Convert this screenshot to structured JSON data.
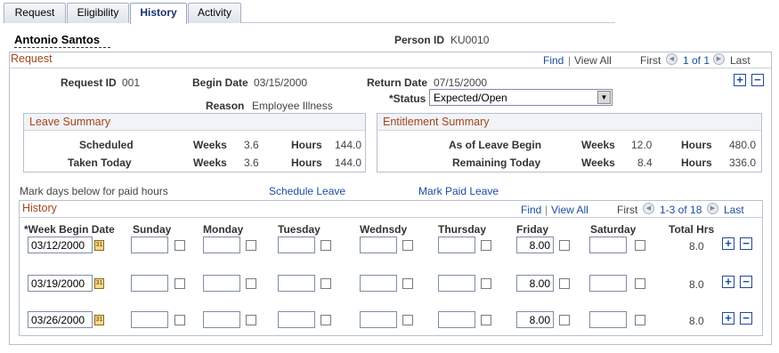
{
  "tabs": [
    "Request",
    "Eligibility",
    "History",
    "Activity"
  ],
  "person": {
    "name": "Antonio Santos",
    "id_label": "Person ID",
    "id_value": "KU0010"
  },
  "request": {
    "title": "Request",
    "find": "Find",
    "view_all": "View All",
    "first": "First",
    "range": "1 of 1",
    "last": "Last",
    "request_id_label": "Request ID",
    "request_id_value": "001",
    "begin_date_label": "Begin Date",
    "begin_date_value": "03/15/2000",
    "return_date_label": "Return Date",
    "return_date_value": "07/15/2000",
    "status_label": "*Status",
    "status_value": "Expected/Open",
    "reason_label": "Reason",
    "reason_value": "Employee Illness"
  },
  "leave_summary": {
    "title": "Leave Summary",
    "rows": [
      {
        "label": "Scheduled",
        "weeks_label": "Weeks",
        "weeks": "3.6",
        "hours_label": "Hours",
        "hours": "144.0"
      },
      {
        "label": "Taken Today",
        "weeks_label": "Weeks",
        "weeks": "3.6",
        "hours_label": "Hours",
        "hours": "144.0"
      }
    ]
  },
  "entitlement_summary": {
    "title": "Entitlement Summary",
    "rows": [
      {
        "label": "As of Leave Begin",
        "weeks_label": "Weeks",
        "weeks": "12.0",
        "hours_label": "Hours",
        "hours": "480.0"
      },
      {
        "label": "Remaining Today",
        "weeks_label": "Weeks",
        "weeks": "8.4",
        "hours_label": "Hours",
        "hours": "336.0"
      }
    ]
  },
  "mark_days_text": "Mark days below for paid hours",
  "schedule_leave": "Schedule Leave",
  "mark_paid_leave": "Mark Paid Leave",
  "history": {
    "title": "History",
    "find": "Find",
    "view_all": "View All",
    "first": "First",
    "range": "1-3 of 18",
    "last": "Last",
    "headers": [
      "*Week Begin Date",
      "Sunday",
      "Monday",
      "Tuesday",
      "Wednsdy",
      "Thursday",
      "Friday",
      "Saturday",
      "Total Hrs"
    ],
    "rows": [
      {
        "week": "03/12/2000",
        "friday": "8.00",
        "total": "8.0"
      },
      {
        "week": "03/19/2000",
        "friday": "8.00",
        "total": "8.0"
      },
      {
        "week": "03/26/2000",
        "friday": "8.00",
        "total": "8.0"
      }
    ]
  },
  "icons": {
    "calendar": "31",
    "add": "+",
    "remove": "−",
    "prev": "◀",
    "next": "▶",
    "dropdown": "▼"
  },
  "colors": {
    "section_title": "#a4451c",
    "link": "#1c4da1",
    "active_tab": "#1a2f6e"
  }
}
